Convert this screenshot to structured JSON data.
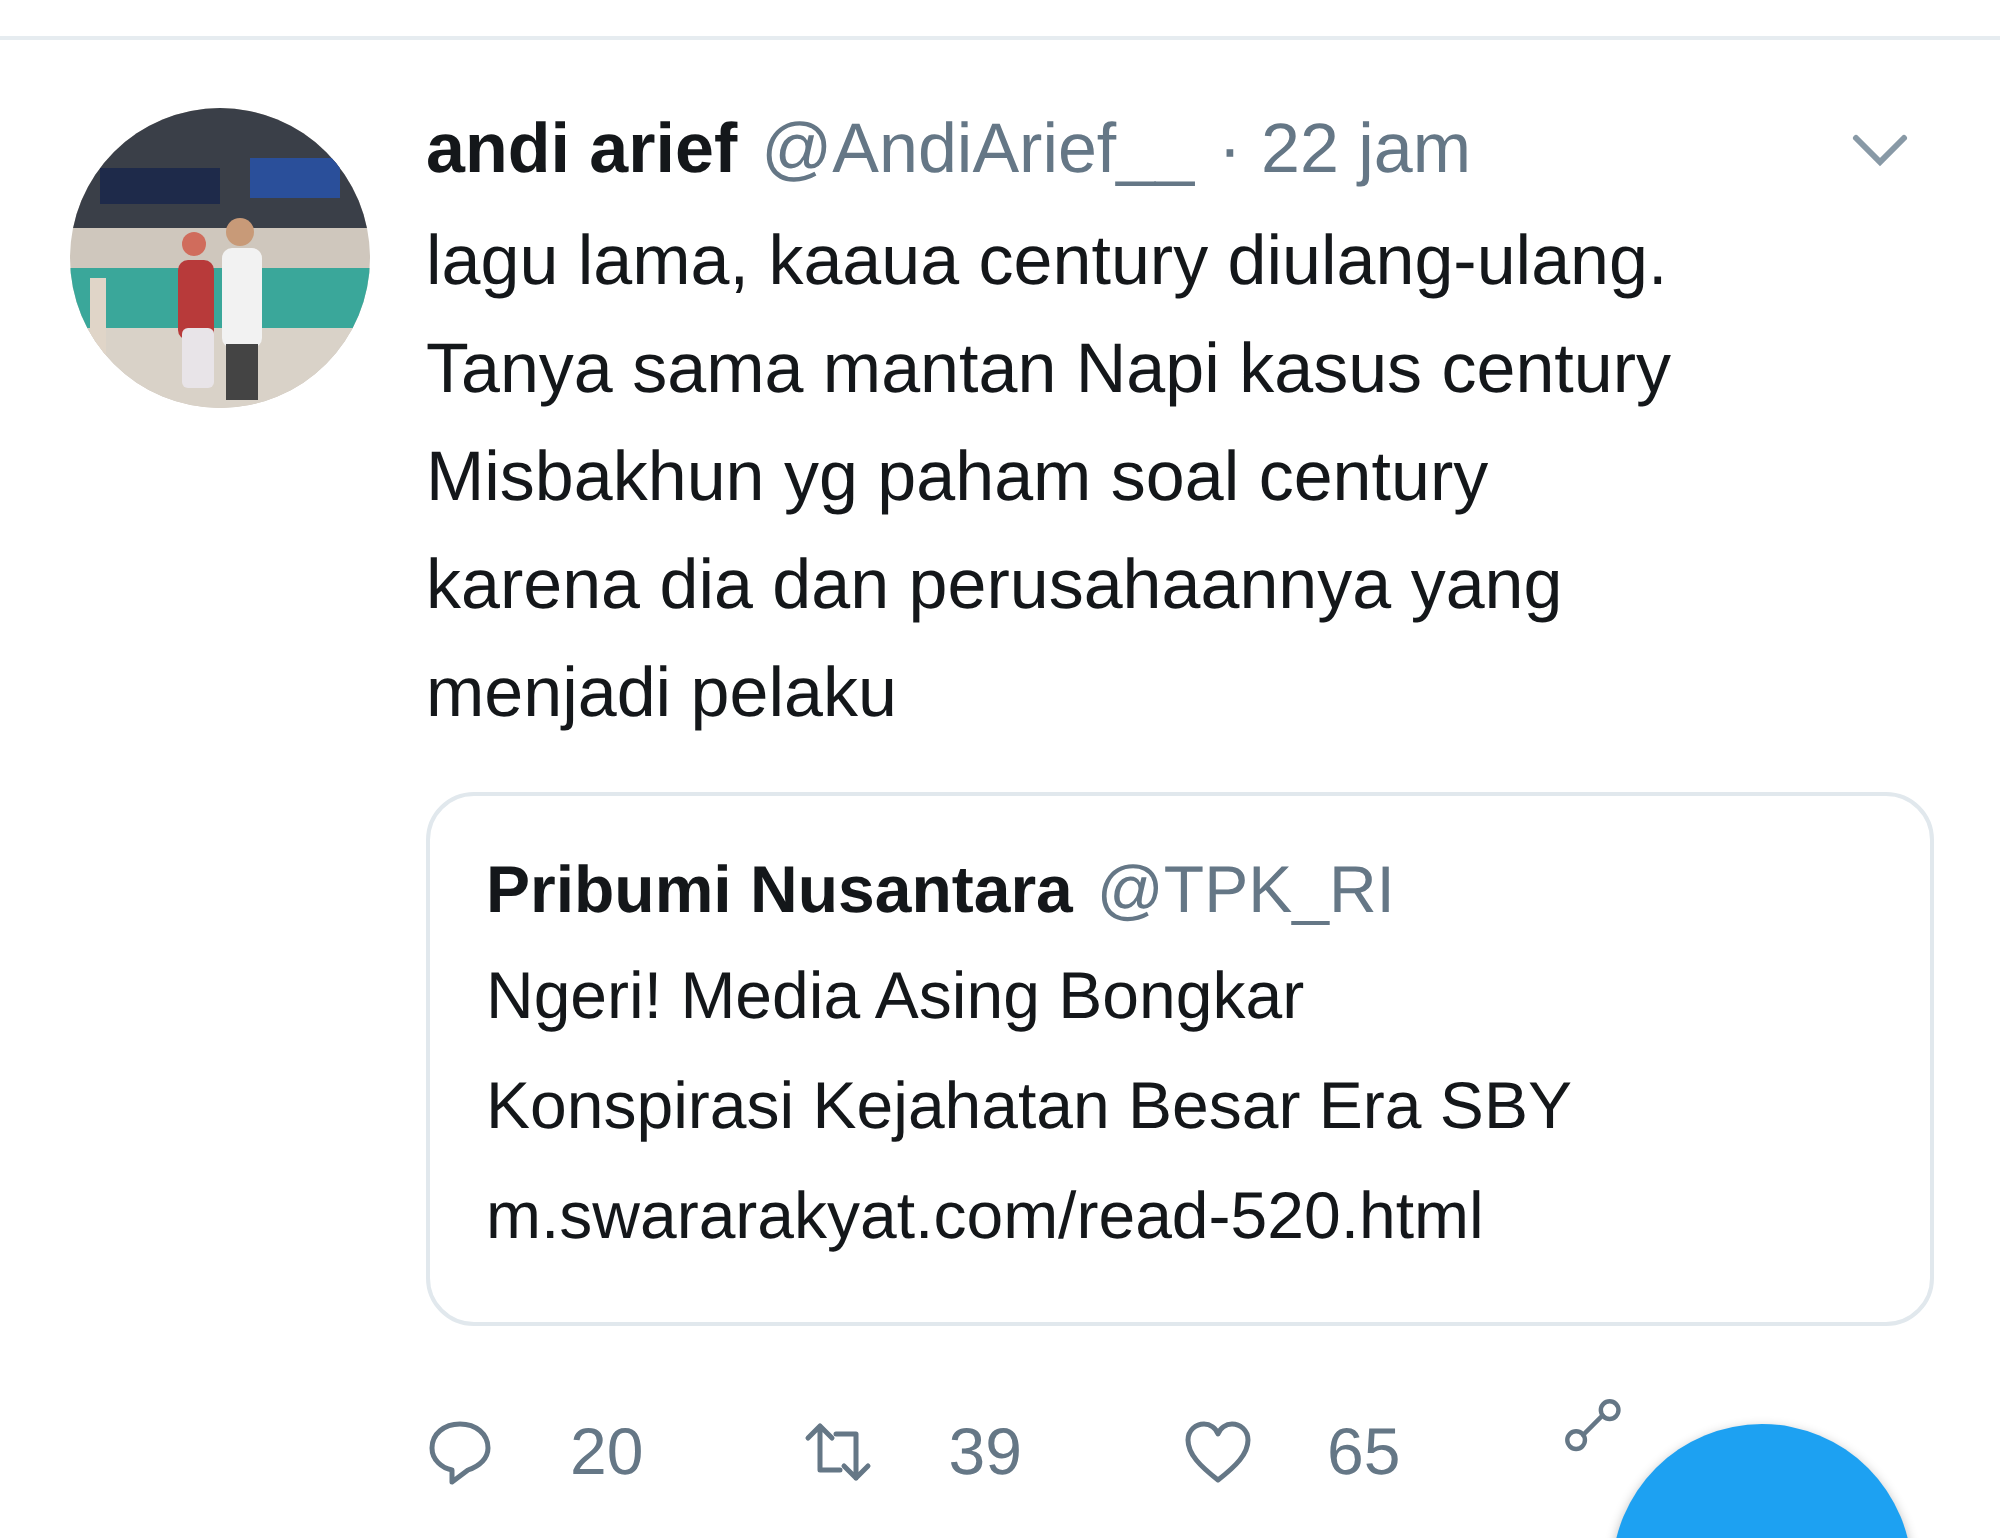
{
  "tweet": {
    "name": "andi arief",
    "handle": "@AndiArief__",
    "time": "· 22 jam",
    "text": [
      "lagu lama, kaaua century diulang-ulang.",
      "Tanya sama mantan Napi kasus century",
      "Misbakhun yg paham soal century",
      "karena dia dan perusahaannya yang",
      "menjadi pelaku"
    ],
    "quote": {
      "name": "Pribumi Nusantara",
      "handle": "@TPK_RI",
      "text": [
        "Ngeri! Media Asing Bongkar",
        "Konspirasi Kejahatan Besar Era SBY"
      ],
      "link": "m.swararakyat.com/read-520.html"
    },
    "actions": [
      {
        "kind": "reply",
        "count": "20"
      },
      {
        "kind": "retweet",
        "count": "39"
      },
      {
        "kind": "like",
        "count": "65"
      },
      {
        "kind": "share"
      }
    ]
  }
}
